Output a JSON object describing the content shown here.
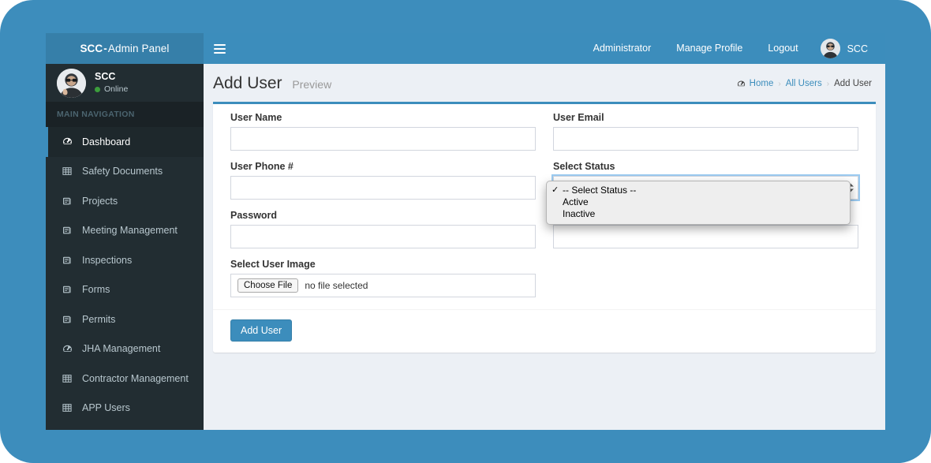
{
  "brand": {
    "logo_mini": "SCC",
    "logo_sep": "-",
    "logo_large": "Admin Panel",
    "accent_color": "#3c8dbc",
    "accent_dark": "#367fa9",
    "sidebar_color": "#222d32",
    "content_bg": "#ecf0f5"
  },
  "topnav": {
    "toggle_icon": "hamburger-icon",
    "links": [
      {
        "label": "Administrator"
      },
      {
        "label": "Manage Profile"
      },
      {
        "label": "Logout"
      }
    ],
    "user": {
      "name": "SCC",
      "avatar_icon": "user-avatar"
    }
  },
  "sidebar": {
    "user_panel": {
      "name": "SCC",
      "status": "Online",
      "status_color": "#3c9e3c",
      "avatar_icon": "user-avatar"
    },
    "nav_header": "MAIN NAVIGATION",
    "items": [
      {
        "label": "Dashboard",
        "icon": "dashboard-icon",
        "active": true
      },
      {
        "label": "Safety Documents",
        "icon": "table-icon",
        "active": false
      },
      {
        "label": "Projects",
        "icon": "book-icon",
        "active": false
      },
      {
        "label": "Meeting Management",
        "icon": "book-icon",
        "active": false
      },
      {
        "label": "Inspections",
        "icon": "book-icon",
        "active": false
      },
      {
        "label": "Forms",
        "icon": "book-icon",
        "active": false
      },
      {
        "label": "Permits",
        "icon": "book-icon",
        "active": false
      },
      {
        "label": "JHA Management",
        "icon": "dashboard-icon",
        "active": false
      },
      {
        "label": "Contractor Management",
        "icon": "table-icon",
        "active": false
      },
      {
        "label": "APP Users",
        "icon": "table-icon",
        "active": false
      }
    ]
  },
  "page": {
    "title": "Add User",
    "subtitle": "Preview",
    "breadcrumb": {
      "home_icon": "dashboard-icon",
      "items": [
        {
          "label": "Home",
          "current": false
        },
        {
          "label": "All Users",
          "current": false
        },
        {
          "label": "Add User",
          "current": true
        }
      ],
      "separator": "›"
    }
  },
  "form": {
    "fields": {
      "user_name": {
        "label": "User Name",
        "value": "",
        "placeholder": ""
      },
      "user_email": {
        "label": "User Email",
        "value": "",
        "placeholder": ""
      },
      "user_phone": {
        "label": "User Phone #",
        "value": "",
        "placeholder": ""
      },
      "select_status": {
        "label": "Select Status"
      },
      "password": {
        "label": "Password",
        "value": "",
        "placeholder": ""
      },
      "hidden_field": {
        "value": "",
        "placeholder": ""
      },
      "user_image": {
        "label": "Select User Image",
        "button": "Choose File",
        "file_status": "no file selected"
      }
    },
    "status_dropdown": {
      "open": true,
      "selected": "-- Select Status --",
      "check_glyph": "✓",
      "options": [
        {
          "label": "-- Select Status --",
          "selected": true
        },
        {
          "label": "Active",
          "selected": false
        },
        {
          "label": "Inactive",
          "selected": false
        }
      ]
    },
    "submit_button": "Add User"
  }
}
